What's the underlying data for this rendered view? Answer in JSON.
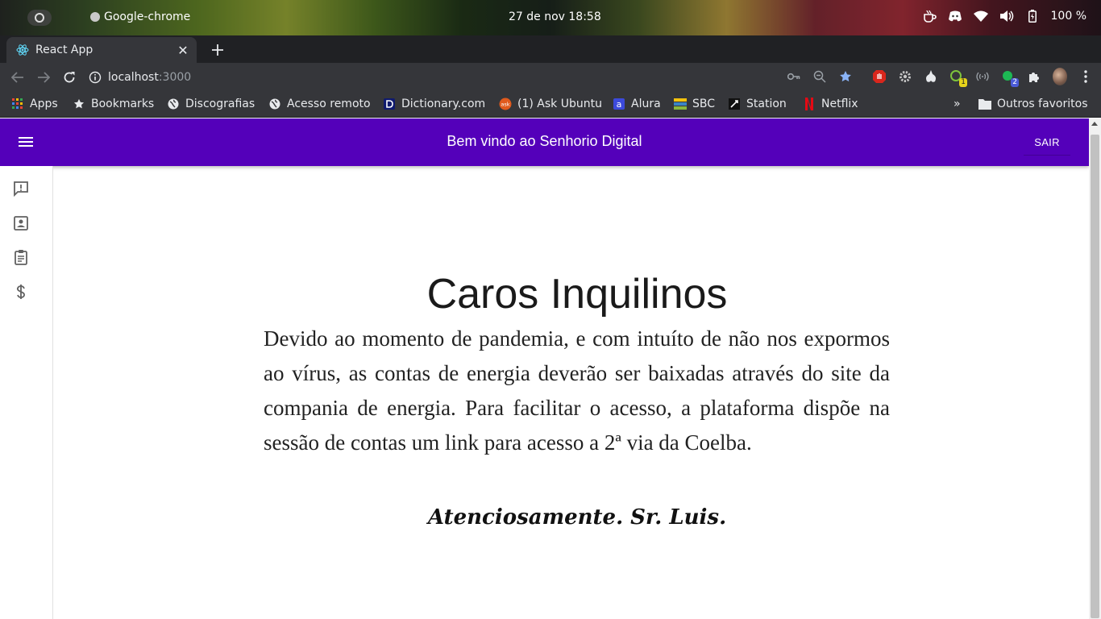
{
  "os_panel": {
    "app_name": "Google-chrome",
    "clock": "27 de nov  18:58",
    "battery_percent": "100 %"
  },
  "browser": {
    "tab_title": "React App",
    "url_host": "localhost",
    "url_port": ":3000",
    "bookmarks": [
      {
        "label": "Apps",
        "icon": "apps-grid-icon"
      },
      {
        "label": "Bookmarks",
        "icon": "star-icon"
      },
      {
        "label": "Discografias",
        "icon": "globe-icon"
      },
      {
        "label": "Acesso remoto",
        "icon": "globe-icon"
      },
      {
        "label": "Dictionary.com",
        "icon": "dictionary-icon"
      },
      {
        "label": "(1) Ask Ubuntu",
        "icon": "askubuntu-icon"
      },
      {
        "label": "Alura",
        "icon": "alura-icon"
      },
      {
        "label": "SBC",
        "icon": "sbc-icon"
      },
      {
        "label": "Station",
        "icon": "station-icon"
      },
      {
        "label": "Netflix",
        "icon": "netflix-icon"
      }
    ],
    "overflow_label": "»",
    "other_bookmarks": "Outros favoritos",
    "extension_badges": {
      "first": "1",
      "second": "2"
    }
  },
  "app": {
    "header_title": "Bem vindo ao Senhorio Digital",
    "logout_label": "SAIR",
    "accent_color": "#5400ba",
    "side_rail": [
      {
        "name": "feedback-icon"
      },
      {
        "name": "contact-card-icon"
      },
      {
        "name": "clipboard-icon"
      },
      {
        "name": "dollar-icon"
      }
    ],
    "page_title": "Caros Inquilinos",
    "notice": "Devido ao momento de pandemia, e com intuíto de não nos expormos ao vírus, as contas de energia deverão ser baixadas através do site da compania de energia. Para facilitar o acesso, a plataforma dispõe na sessão de contas um link para acesso a 2ª via da Coelba.",
    "signoff": "Atenciosamente. Sr. Luis."
  }
}
